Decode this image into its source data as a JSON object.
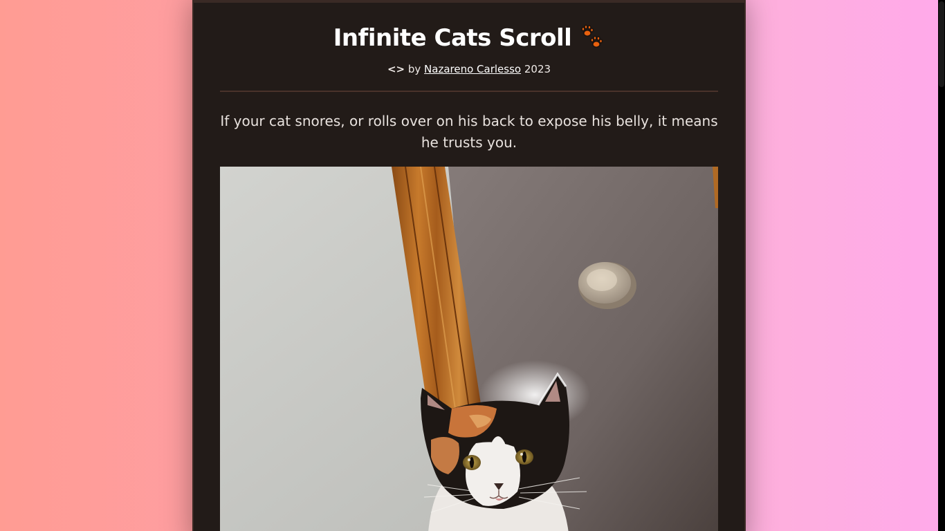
{
  "header": {
    "title": "Infinite Cats Scroll",
    "paw_icon": "paw-prints-icon",
    "code_symbol": "<>",
    "by_text": "by",
    "author": "Nazareno Carlesso",
    "year": "2023"
  },
  "fact": {
    "text": "If your cat snores, or rolls over on his back to expose his belly, it means he trusts you."
  },
  "photo": {
    "subject": "calico-kitten-photo"
  },
  "colors": {
    "card_bg": "#221b18",
    "divider": "#4a322a",
    "paw": "#e8610e",
    "bg_left": "#ff9c93",
    "bg_right": "#ffa9ea"
  }
}
